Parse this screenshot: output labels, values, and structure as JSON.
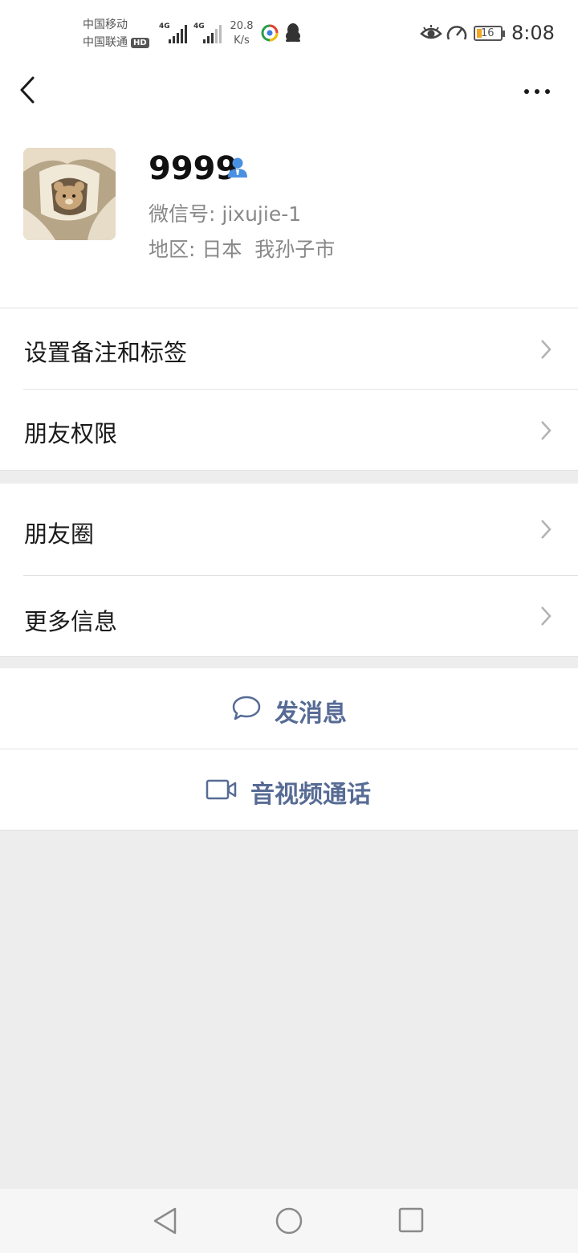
{
  "status_bar": {
    "carrier_1": "中国移动",
    "carrier_2": "中国联通",
    "hd_badge": "HD",
    "signal_1_label": "4G",
    "signal_2_label": "4G",
    "net_speed_value": "20.8",
    "net_speed_unit": "K/s",
    "battery_level": "16",
    "time": "8:08",
    "icons": [
      "browser-app-icon",
      "qq-penguin-icon",
      "eye-icon",
      "speed-gauge-icon",
      "battery-icon"
    ]
  },
  "header": {
    "back_icon": "chevron-left-icon",
    "more_icon": "more-dots-icon"
  },
  "profile": {
    "name": "9999",
    "name_badge_icon": "user-icon",
    "wechat_id_label": "微信号:",
    "wechat_id_value": "jixujie-1",
    "region_label": "地区:",
    "region_value": "日本  我孙子市"
  },
  "menu_group_1": [
    {
      "label": "设置备注和标签"
    },
    {
      "label": "朋友权限"
    }
  ],
  "menu_group_2": [
    {
      "label": "朋友圈"
    },
    {
      "label": "更多信息"
    }
  ],
  "actions": {
    "message_label": "发消息",
    "call_label": "音视频通话"
  },
  "colors": {
    "accent_link": "#576b95",
    "background": "#ededed",
    "user_badge": "#4a90e2"
  }
}
